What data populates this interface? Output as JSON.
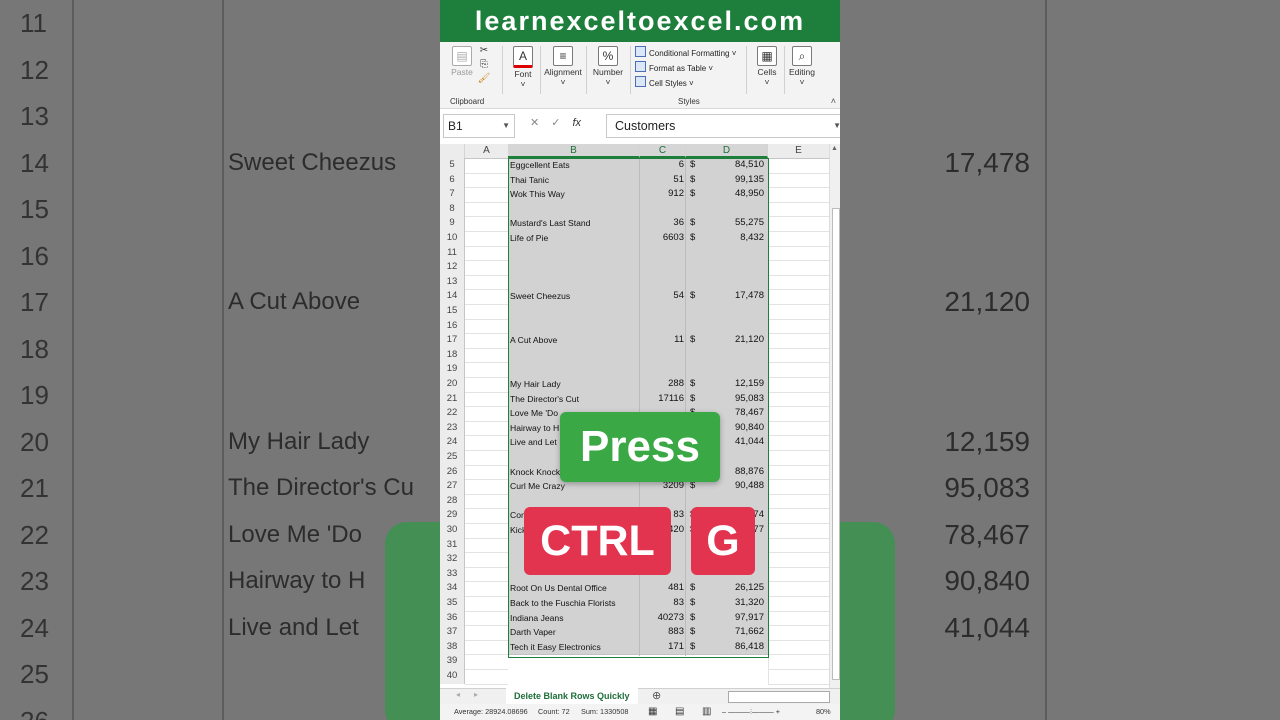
{
  "banner": "learnexceltoexcel.com",
  "ribbon": {
    "paste": "Paste",
    "font": "Font",
    "alignment": "Alignment",
    "number": "Number",
    "conditional_formatting": "Conditional Formatting ˅",
    "format_as_table": "Format as Table ˅",
    "cell_styles": "Cell Styles ˅",
    "cells": "Cells",
    "editing": "Editing",
    "clipboard_group": "Clipboard",
    "styles_group": "Styles"
  },
  "formula_bar": {
    "name_box": "B1",
    "fx": "fx",
    "value": "Customers"
  },
  "columns": [
    "A",
    "B",
    "C",
    "D",
    "E"
  ],
  "rows": [
    {
      "n": "5",
      "b": "Eggcellent Eats",
      "c": "6",
      "d": "84,510"
    },
    {
      "n": "6",
      "b": "Thai Tanic",
      "c": "51",
      "d": "99,135"
    },
    {
      "n": "7",
      "b": "Wok This Way",
      "c": "912",
      "d": "48,950"
    },
    {
      "n": "8",
      "b": "",
      "c": "",
      "d": ""
    },
    {
      "n": "9",
      "b": "Mustard's Last Stand",
      "c": "36",
      "d": "55,275"
    },
    {
      "n": "10",
      "b": "Life of Pie",
      "c": "6603",
      "d": "8,432"
    },
    {
      "n": "11",
      "b": "",
      "c": "",
      "d": ""
    },
    {
      "n": "12",
      "b": "",
      "c": "",
      "d": ""
    },
    {
      "n": "13",
      "b": "",
      "c": "",
      "d": ""
    },
    {
      "n": "14",
      "b": "Sweet Cheezus",
      "c": "54",
      "d": "17,478"
    },
    {
      "n": "15",
      "b": "",
      "c": "",
      "d": ""
    },
    {
      "n": "16",
      "b": "",
      "c": "",
      "d": ""
    },
    {
      "n": "17",
      "b": "A Cut Above",
      "c": "11",
      "d": "21,120"
    },
    {
      "n": "18",
      "b": "",
      "c": "",
      "d": ""
    },
    {
      "n": "19",
      "b": "",
      "c": "",
      "d": ""
    },
    {
      "n": "20",
      "b": "My Hair Lady",
      "c": "288",
      "d": "12,159"
    },
    {
      "n": "21",
      "b": "The Director's Cut",
      "c": "17116",
      "d": "95,083"
    },
    {
      "n": "22",
      "b": "Love Me 'Do",
      "c": "",
      "d": "78,467"
    },
    {
      "n": "23",
      "b": "Hairway to H",
      "c": "",
      "d": "90,840"
    },
    {
      "n": "24",
      "b": "Live and Let",
      "c": "",
      "d": "41,044"
    },
    {
      "n": "25",
      "b": "",
      "c": "",
      "d": ""
    },
    {
      "n": "26",
      "b": "Knock Knock",
      "c": "",
      "d": "88,876"
    },
    {
      "n": "27",
      "b": "Curl Me Crazy",
      "c": "3209",
      "d": "90,488"
    },
    {
      "n": "28",
      "b": "",
      "c": "",
      "d": ""
    },
    {
      "n": "29",
      "b": "Con",
      "c": "83",
      "d": "74"
    },
    {
      "n": "30",
      "b": "Kick",
      "c": "420",
      "d": "77"
    },
    {
      "n": "31",
      "b": "",
      "c": "",
      "d": ""
    },
    {
      "n": "32",
      "b": "",
      "c": "",
      "d": ""
    },
    {
      "n": "33",
      "b": "",
      "c": "",
      "d": ""
    },
    {
      "n": "34",
      "b": "Root On Us Dental Office",
      "c": "481",
      "d": "26,125"
    },
    {
      "n": "35",
      "b": "Back to the Fuschia Florists",
      "c": "83",
      "d": "31,320"
    },
    {
      "n": "36",
      "b": "Indiana Jeans",
      "c": "40273",
      "d": "97,917"
    },
    {
      "n": "37",
      "b": "Darth Vaper",
      "c": "883",
      "d": "71,662"
    },
    {
      "n": "38",
      "b": "Tech it Easy Electronics",
      "c": "171",
      "d": "86,418"
    },
    {
      "n": "39",
      "b": "",
      "c": "",
      "d": ""
    },
    {
      "n": "40",
      "b": "",
      "c": "",
      "d": ""
    }
  ],
  "currency_symbol": "$",
  "sheet_tab": "Delete Blank Rows Quickly",
  "status": {
    "average": "Average: 28924.08696",
    "count": "Count: 72",
    "sum": "Sum: 1330508",
    "zoom": "80%"
  },
  "overlays": {
    "press": "Press",
    "ctrl": "CTRL",
    "g": "G"
  },
  "background_rows": [
    {
      "n": "11",
      "name": "",
      "val": ""
    },
    {
      "n": "12",
      "name": "",
      "val": ""
    },
    {
      "n": "13",
      "name": "",
      "val": ""
    },
    {
      "n": "14",
      "name": "Sweet Cheezus",
      "val": "17,478"
    },
    {
      "n": "15",
      "name": "",
      "val": ""
    },
    {
      "n": "16",
      "name": "",
      "val": ""
    },
    {
      "n": "17",
      "name": "A Cut Above",
      "val": "21,120"
    },
    {
      "n": "18",
      "name": "",
      "val": ""
    },
    {
      "n": "19",
      "name": "",
      "val": ""
    },
    {
      "n": "20",
      "name": "My Hair Lady",
      "val": "12,159"
    },
    {
      "n": "21",
      "name": "The Director's Cu",
      "val": "95,083"
    },
    {
      "n": "22",
      "name": "Love Me 'Do",
      "val": "78,467"
    },
    {
      "n": "23",
      "name": "Hairway to H",
      "val": "90,840"
    },
    {
      "n": "24",
      "name": "Live and Let",
      "val": "41,044"
    },
    {
      "n": "25",
      "name": "",
      "val": ""
    },
    {
      "n": "26",
      "name": "",
      "val": ""
    }
  ]
}
